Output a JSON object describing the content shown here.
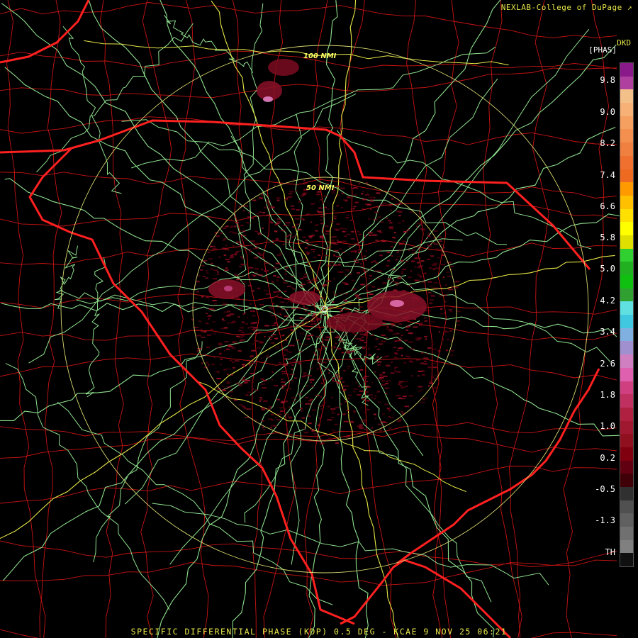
{
  "credit": "NEXLAB-College of DuPage",
  "site_code": "DKD",
  "unit_label": "[PHAS]",
  "footer": "SPECIFIC DIFFERENTIAL PHASE (KDP) 0.5 DEG - KCAE 9 NOV 25 06:21",
  "range_rings": [
    {
      "label": "100 NMI",
      "color": "#ffff66"
    },
    {
      "label": "50 NMI",
      "color": "#ffff66"
    }
  ],
  "colors": {
    "state_border": "#ff2020",
    "county_border": "#c81414",
    "highway": "#8ee08e",
    "interstate": "#e8e84a",
    "ring": "#d8d870",
    "text": "#e8e84a"
  },
  "colorbar": {
    "labels": [
      "9.8",
      "9.0",
      "8.2",
      "7.4",
      "6.6",
      "5.8",
      "5.0",
      "4.2",
      "3.4",
      "2.6",
      "1.8",
      "1.0",
      "0.2",
      "-0.5",
      "-1.3",
      "TH"
    ],
    "segments": [
      "#8a1a8a",
      "#b040a0",
      "#f4c08a",
      "#f7b176",
      "#f5a060",
      "#f39050",
      "#f08040",
      "#f07030",
      "#ee6a20",
      "#ff9a00",
      "#ffc000",
      "#ffe000",
      "#ffff00",
      "#e0e000",
      "#30d030",
      "#20b020",
      "#10c010",
      "#30a030",
      "#60e0e0",
      "#40c8e0",
      "#80b0e0",
      "#a090d0",
      "#d080c0",
      "#e060b0",
      "#d04080",
      "#c03060",
      "#b02040",
      "#a01830",
      "#901020",
      "#800010",
      "#600010",
      "#400008",
      "#303030",
      "#505050",
      "#606060",
      "#707070",
      "#808080",
      "#101010"
    ]
  }
}
